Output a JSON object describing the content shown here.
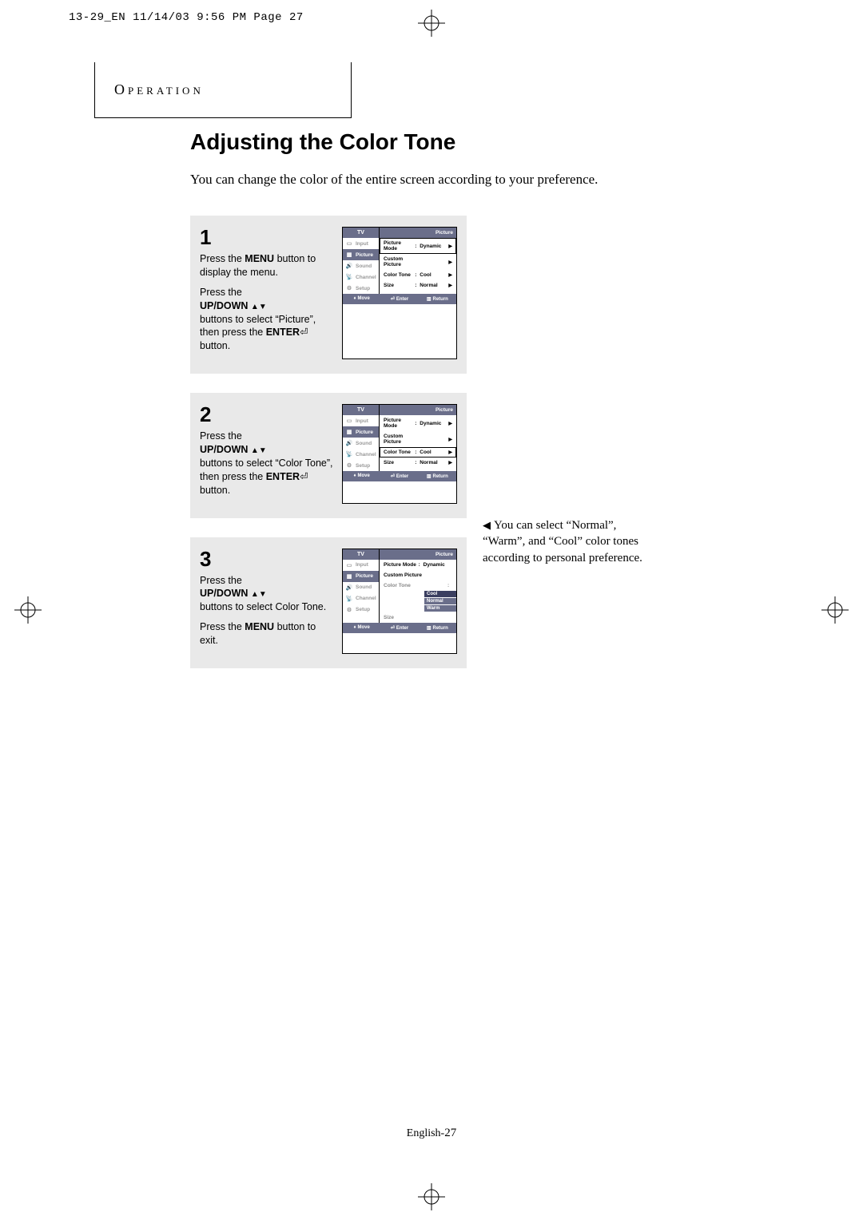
{
  "print_header": "13-29_EN  11/14/03 9:56 PM  Page 27",
  "section_label": "Operation",
  "title": "Adjusting the Color Tone",
  "intro": "You can change the color of the entire screen according to your preference.",
  "steps": {
    "s1": {
      "num": "1",
      "p1a": "Press the ",
      "p1b": "MENU",
      "p1c": " button to display the menu.",
      "p2a": "Press the",
      "p2b": "UP/DOWN",
      "p2c": "buttons to select “Picture”, then press the ",
      "p2d": "ENTER",
      "p2e": " button."
    },
    "s2": {
      "num": "2",
      "p1a": "Press the",
      "p1b": "UP/DOWN",
      "p1c": "buttons to select “Color Tone”, then press the ",
      "p1d": "ENTER",
      "p1e": " button."
    },
    "s3": {
      "num": "3",
      "p1a": "Press the",
      "p1b": "UP/DOWN",
      "p1c": "buttons to select Color Tone.",
      "p2a": "Press the ",
      "p2b": "MENU",
      "p2c": " button to exit."
    }
  },
  "osd": {
    "tv": "TV",
    "section": "Picture",
    "side": {
      "input": "Input",
      "picture": "Picture",
      "sound": "Sound",
      "channel": "Channel",
      "setup": "Setup"
    },
    "rows": {
      "picture_mode": "Picture Mode",
      "custom_picture": "Custom Picture",
      "color_tone": "Color Tone",
      "size": "Size"
    },
    "vals": {
      "dynamic": "Dynamic",
      "cool": "Cool",
      "normal": "Normal",
      "warm": "Warm"
    },
    "footer": {
      "move": "Move",
      "enter": "Enter",
      "return": "Return"
    }
  },
  "note": "You can select “Normal”, “Warm”, and “Cool” color tones according to personal preference.",
  "foot_lang": "English-",
  "foot_page": "27"
}
